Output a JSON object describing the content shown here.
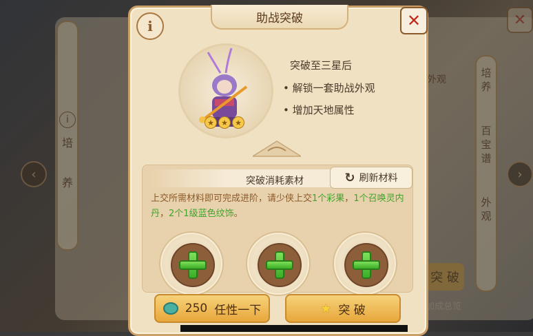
{
  "dialog": {
    "title": "助战突破",
    "info_label": "i",
    "close_label": "✕"
  },
  "breakthrough": {
    "heading": "突破至三星后",
    "bullets": [
      "• 解锁一套助战外观",
      "• 增加天地属性"
    ],
    "stars": 3
  },
  "materials": {
    "title": "突破消耗素材",
    "refresh_label": "刷新材料",
    "desc_prefix": "上交所需材料即可完成进阶，请少侠上交",
    "desc_item1": "1个彩果",
    "desc_sep1": "，",
    "desc_item2": "1个召唤灵内丹",
    "desc_sep2": "，",
    "desc_item3": "2个1级蓝色纹饰",
    "desc_suffix": "。",
    "slots": 3
  },
  "actions": {
    "cost_value": "250",
    "cost_label": "任性一下",
    "breakthrough_label": "突  破"
  },
  "background": {
    "left_tabs": [
      "培",
      "养"
    ],
    "right_tabs": [
      "培养",
      "百宝谱",
      "外观"
    ],
    "left_info": "i",
    "appearance_label": "外观",
    "breakthrough_btn": "突 破",
    "preview_label": "加成总览"
  },
  "colors": {
    "accent_green": "#3fa32a",
    "close_red": "#c0281c",
    "button_gold": "#e8a73c"
  }
}
